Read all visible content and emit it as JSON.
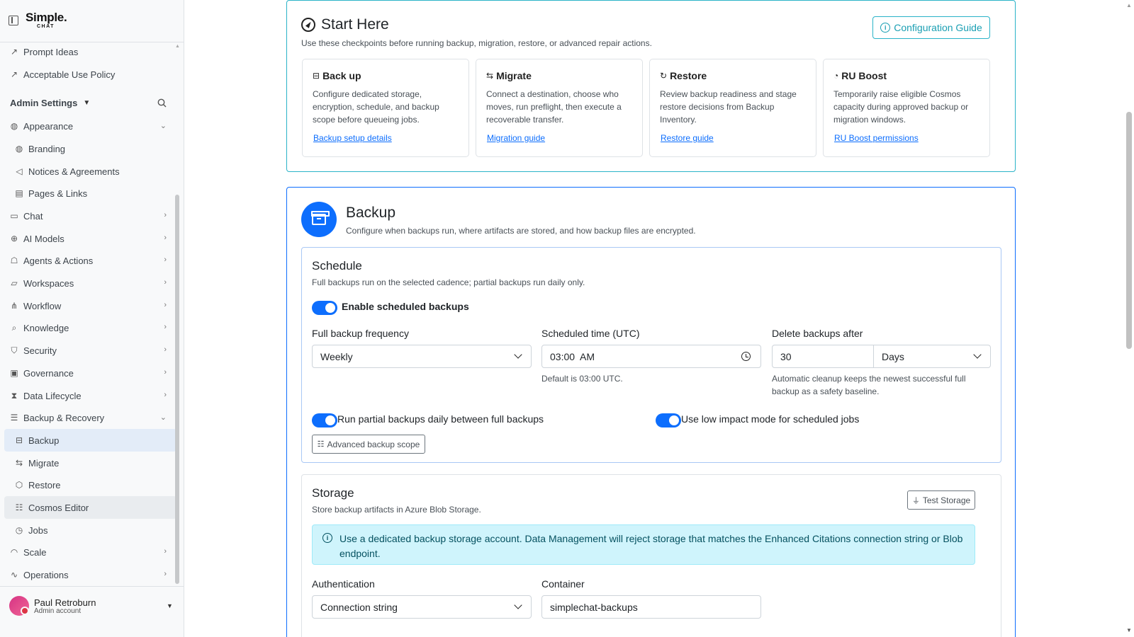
{
  "brand": {
    "name": "Simple.",
    "sub": "CHAT"
  },
  "sidebar": {
    "top_links": [
      {
        "label": "Prompt Ideas",
        "icon": "external-link-icon"
      },
      {
        "label": "Acceptable Use Policy",
        "icon": "external-link-icon"
      }
    ],
    "admin_header": "Admin Settings",
    "items": [
      {
        "label": "Appearance",
        "icon": "palette-icon",
        "expanded": true
      },
      {
        "label": "Branding",
        "icon": "palette-icon",
        "sub": true
      },
      {
        "label": "Notices & Agreements",
        "icon": "megaphone-icon",
        "sub": true
      },
      {
        "label": "Pages & Links",
        "icon": "pages-icon",
        "sub": true
      },
      {
        "label": "Chat",
        "icon": "chat-icon"
      },
      {
        "label": "AI Models",
        "icon": "cpu-icon"
      },
      {
        "label": "Agents & Actions",
        "icon": "robot-icon"
      },
      {
        "label": "Workspaces",
        "icon": "folder-icon"
      },
      {
        "label": "Workflow",
        "icon": "workflow-icon"
      },
      {
        "label": "Knowledge",
        "icon": "search-icon"
      },
      {
        "label": "Security",
        "icon": "shield-icon"
      },
      {
        "label": "Governance",
        "icon": "clipboard-icon"
      },
      {
        "label": "Data Lifecycle",
        "icon": "hourglass-icon"
      },
      {
        "label": "Backup & Recovery",
        "icon": "database-icon",
        "expanded": true
      },
      {
        "label": "Backup",
        "icon": "archive-icon",
        "sub": true,
        "active": true
      },
      {
        "label": "Migrate",
        "icon": "arrows-icon",
        "sub": true
      },
      {
        "label": "Restore",
        "icon": "box-icon",
        "sub": true
      },
      {
        "label": "Cosmos Editor",
        "icon": "database-edit-icon",
        "sub": true
      },
      {
        "label": "Jobs",
        "icon": "clock-icon",
        "sub": true
      },
      {
        "label": "Scale",
        "icon": "speedometer-icon"
      },
      {
        "label": "Operations",
        "icon": "activity-icon"
      }
    ],
    "user": {
      "name": "Paul Retroburn",
      "role": "Admin account"
    }
  },
  "start": {
    "title": "Start Here",
    "subtitle": "Use these checkpoints before running backup, migration, restore, or advanced repair actions.",
    "config_button": "Configuration Guide",
    "tiles": [
      {
        "title": "Back up",
        "icon": "archive-icon",
        "body": "Configure dedicated storage, encryption, schedule, and backup scope before queueing jobs.",
        "link": "Backup setup details"
      },
      {
        "title": "Migrate",
        "icon": "arrows-icon",
        "body": "Connect a destination, choose who moves, run preflight, then execute a recoverable transfer.",
        "link": "Migration guide"
      },
      {
        "title": "Restore",
        "icon": "restore-icon",
        "body": "Review backup readiness and stage restore decisions from Backup Inventory.",
        "link": "Restore guide"
      },
      {
        "title": "RU Boost",
        "icon": "speedometer-icon",
        "body": "Temporarily raise eligible Cosmos capacity during approved backup or migration windows.",
        "link": "RU Boost permissions"
      }
    ]
  },
  "backup": {
    "title": "Backup",
    "subtitle": "Configure when backups run, where artifacts are stored, and how backup files are encrypted.",
    "schedule": {
      "title": "Schedule",
      "subtitle": "Full backups run on the selected cadence; partial backups run daily only.",
      "enable_label": "Enable scheduled backups",
      "freq_label": "Full backup frequency",
      "freq_value": "Weekly",
      "time_label": "Scheduled time (UTC)",
      "time_value": "03:00  AM",
      "time_help": "Default is 03:00 UTC.",
      "delete_label": "Delete backups after",
      "delete_value": "30",
      "delete_unit": "Days",
      "delete_help": "Automatic cleanup keeps the newest successful full backup as a safety baseline.",
      "partial_label": "Run partial backups daily between full backups",
      "lowimpact_label": "Use low impact mode for scheduled jobs",
      "advanced_button": "Advanced backup scope"
    },
    "storage": {
      "title": "Storage",
      "subtitle": "Store backup artifacts in Azure Blob Storage.",
      "test_button": "Test Storage",
      "alert": "Use a dedicated backup storage account. Data Management will reject storage that matches the Enhanced Citations connection string or Blob endpoint.",
      "auth_label": "Authentication",
      "auth_value": "Connection string",
      "container_label": "Container",
      "container_value": "simplechat-backups"
    }
  }
}
